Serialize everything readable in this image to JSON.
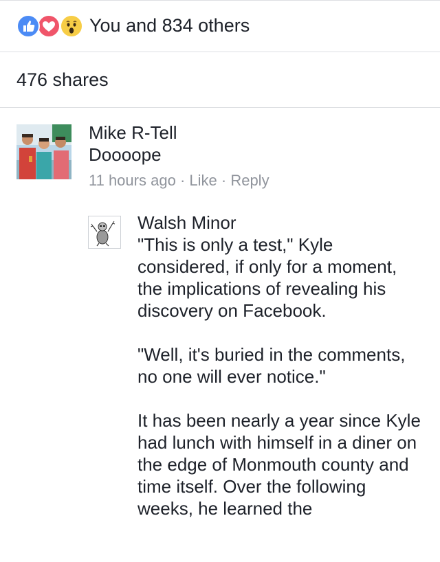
{
  "reactions": {
    "icons": [
      "like-icon",
      "love-icon",
      "wow-icon"
    ],
    "colors": {
      "like": "#4c8bf5",
      "love": "#f0556a",
      "wow": "#f7cd46"
    },
    "summary": "You and 834 others"
  },
  "shares": {
    "label": "476 shares"
  },
  "comment": {
    "author": "Mike R-Tell",
    "text": "Doooope",
    "timestamp": "11 hours ago",
    "separator": "·",
    "like_label": "Like",
    "reply_label": "Reply"
  },
  "reply": {
    "author": "Walsh Minor",
    "paragraphs": [
      "\"This is only a test,\" Kyle considered, if only for a moment, the implications of revealing his discovery on Facebook.",
      "\"Well, it's buried in the comments, no one will ever notice.\"",
      "It has been nearly a year since Kyle had lunch with himself in a diner on the edge of Monmouth county and time itself. Over the following weeks, he learned the"
    ]
  }
}
